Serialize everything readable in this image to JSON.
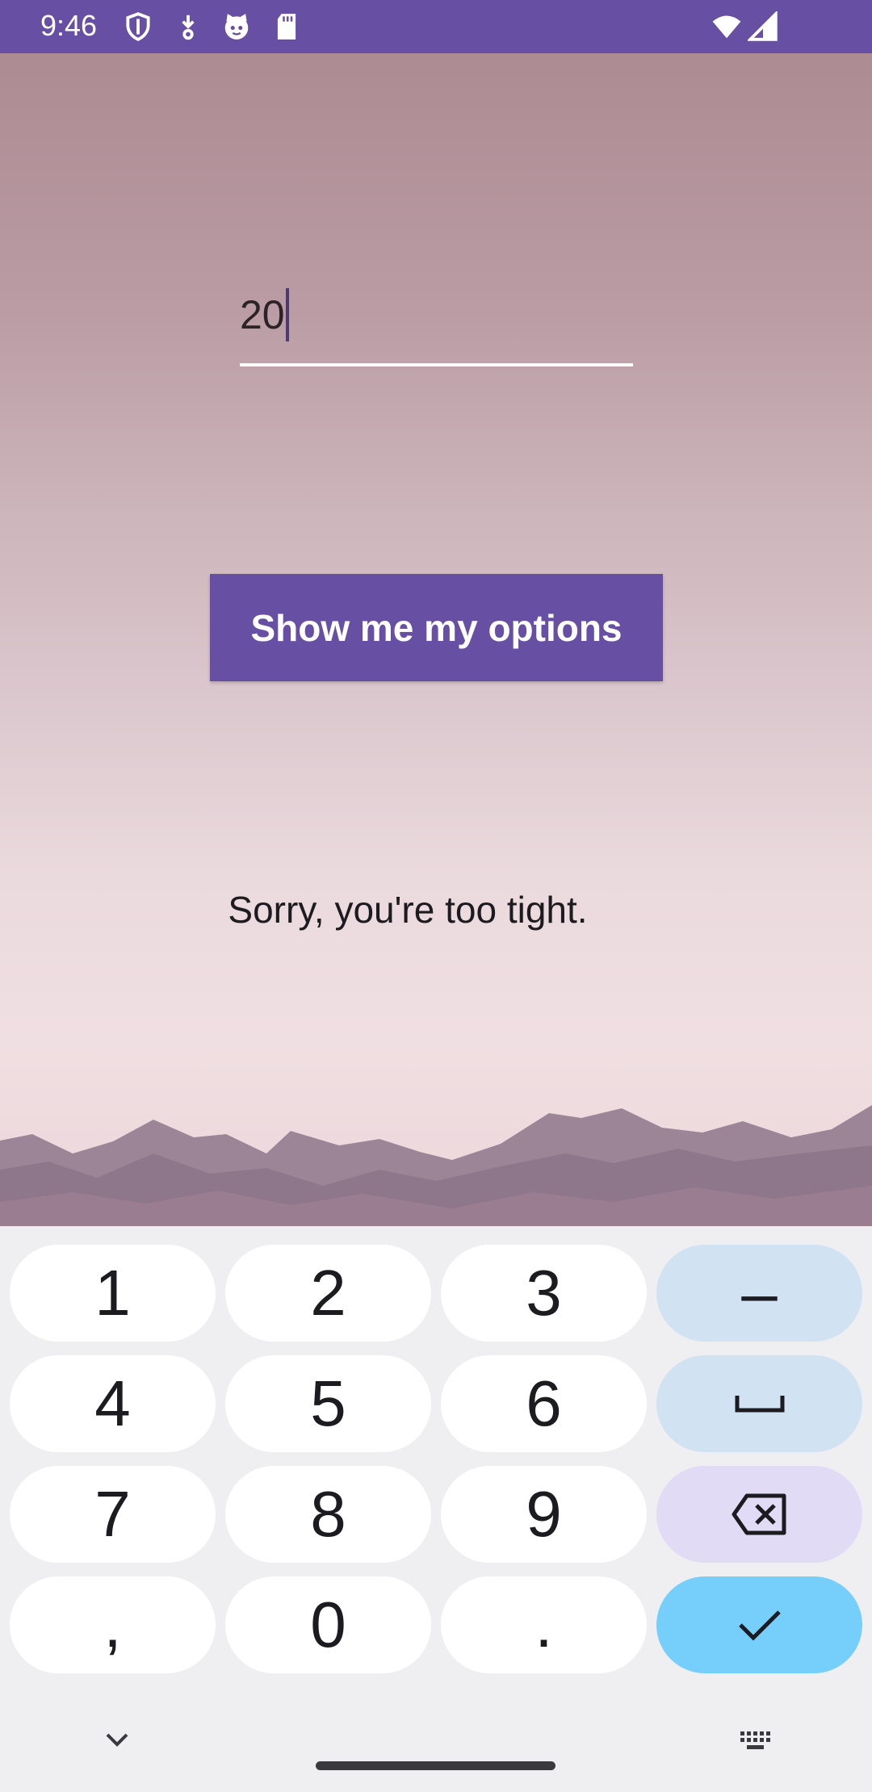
{
  "status_bar": {
    "time": "9:46",
    "left_icons": [
      "shield-icon",
      "download-icon",
      "cat-face-icon",
      "sd-card-icon"
    ],
    "right_icons": [
      "wifi-icon",
      "cellular-signal-icon"
    ],
    "background_color": "#6750a4"
  },
  "form": {
    "amount_value": "20",
    "button_label": "Show me my options",
    "result_message": "Sorry, you're too tight."
  },
  "keyboard": {
    "rows": [
      [
        "1",
        "2",
        "3",
        "–"
      ],
      [
        "4",
        "5",
        "6",
        "␣"
      ],
      [
        "7",
        "8",
        "9",
        "⌫"
      ],
      [
        ",",
        "0",
        ".",
        "✓"
      ]
    ],
    "key_names": [
      [
        "key-1",
        "key-2",
        "key-3",
        "key-minus"
      ],
      [
        "key-4",
        "key-5",
        "key-6",
        "key-space"
      ],
      [
        "key-7",
        "key-8",
        "key-9",
        "key-backspace"
      ],
      [
        "key-comma",
        "key-0",
        "key-period",
        "key-enter"
      ]
    ],
    "bottom_icons": [
      "chevron-down-icon",
      "keyboard-icon"
    ],
    "accent_color": "#75cffa"
  }
}
